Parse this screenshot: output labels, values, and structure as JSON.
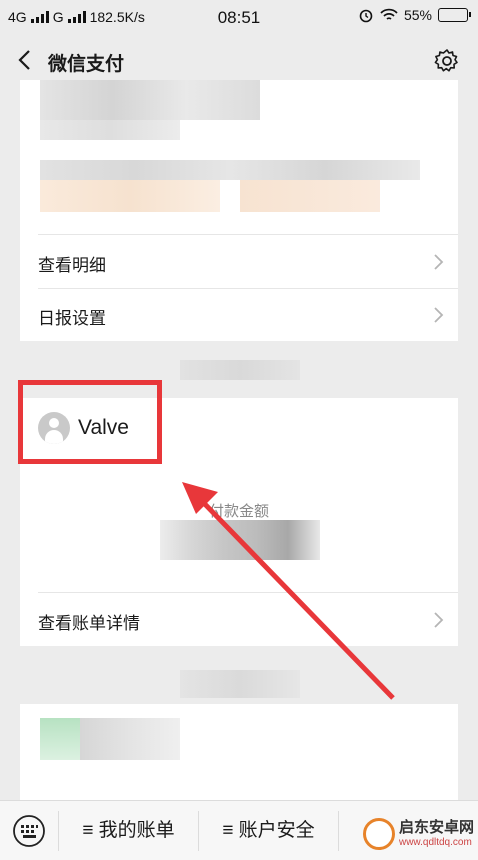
{
  "status_bar": {
    "network1": "4G",
    "network2": "G",
    "speed": "182.5K/s",
    "time": "08:51",
    "battery": "55%",
    "battery_level": 0.55
  },
  "nav": {
    "title": "微信支付",
    "back_icon": "chevron-left-icon",
    "settings_icon": "gear-icon"
  },
  "card1": {
    "rows": [
      {
        "label": "查看明细"
      },
      {
        "label": "日报设置"
      }
    ]
  },
  "card2": {
    "merchant_name": "Valve",
    "payment_amount_label": "付款金额",
    "detail_link": "查看账单详情"
  },
  "tab_bar": {
    "tab1": "≡ 我的账单",
    "tab2": "≡ 账户安全"
  },
  "watermark": {
    "name": "启东安卓网",
    "url": "www.qdltdq.com"
  },
  "colors": {
    "highlight": "#e8373a",
    "accent_green": "#1aad19"
  }
}
